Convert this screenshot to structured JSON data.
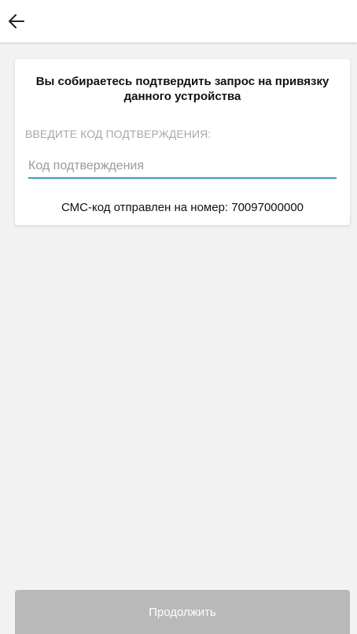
{
  "header": {
    "back_icon": "arrow-left-icon"
  },
  "card": {
    "title": "Вы собираетесь подтвердить запрос на привязку данного устройства",
    "code_label": "ВВЕДИТЕ КОД ПОДТВЕРЖДЕНИЯ:",
    "code_input": {
      "value": "",
      "placeholder": "Код подтверждения"
    },
    "sms_info": "СМС-код отправлен на номер: 70097000000"
  },
  "footer": {
    "continue_label": "Продолжить"
  },
  "colors": {
    "background": "#f2f2f2",
    "input_underline": "#3aa0bf",
    "button_disabled": "#b9b9b9"
  }
}
